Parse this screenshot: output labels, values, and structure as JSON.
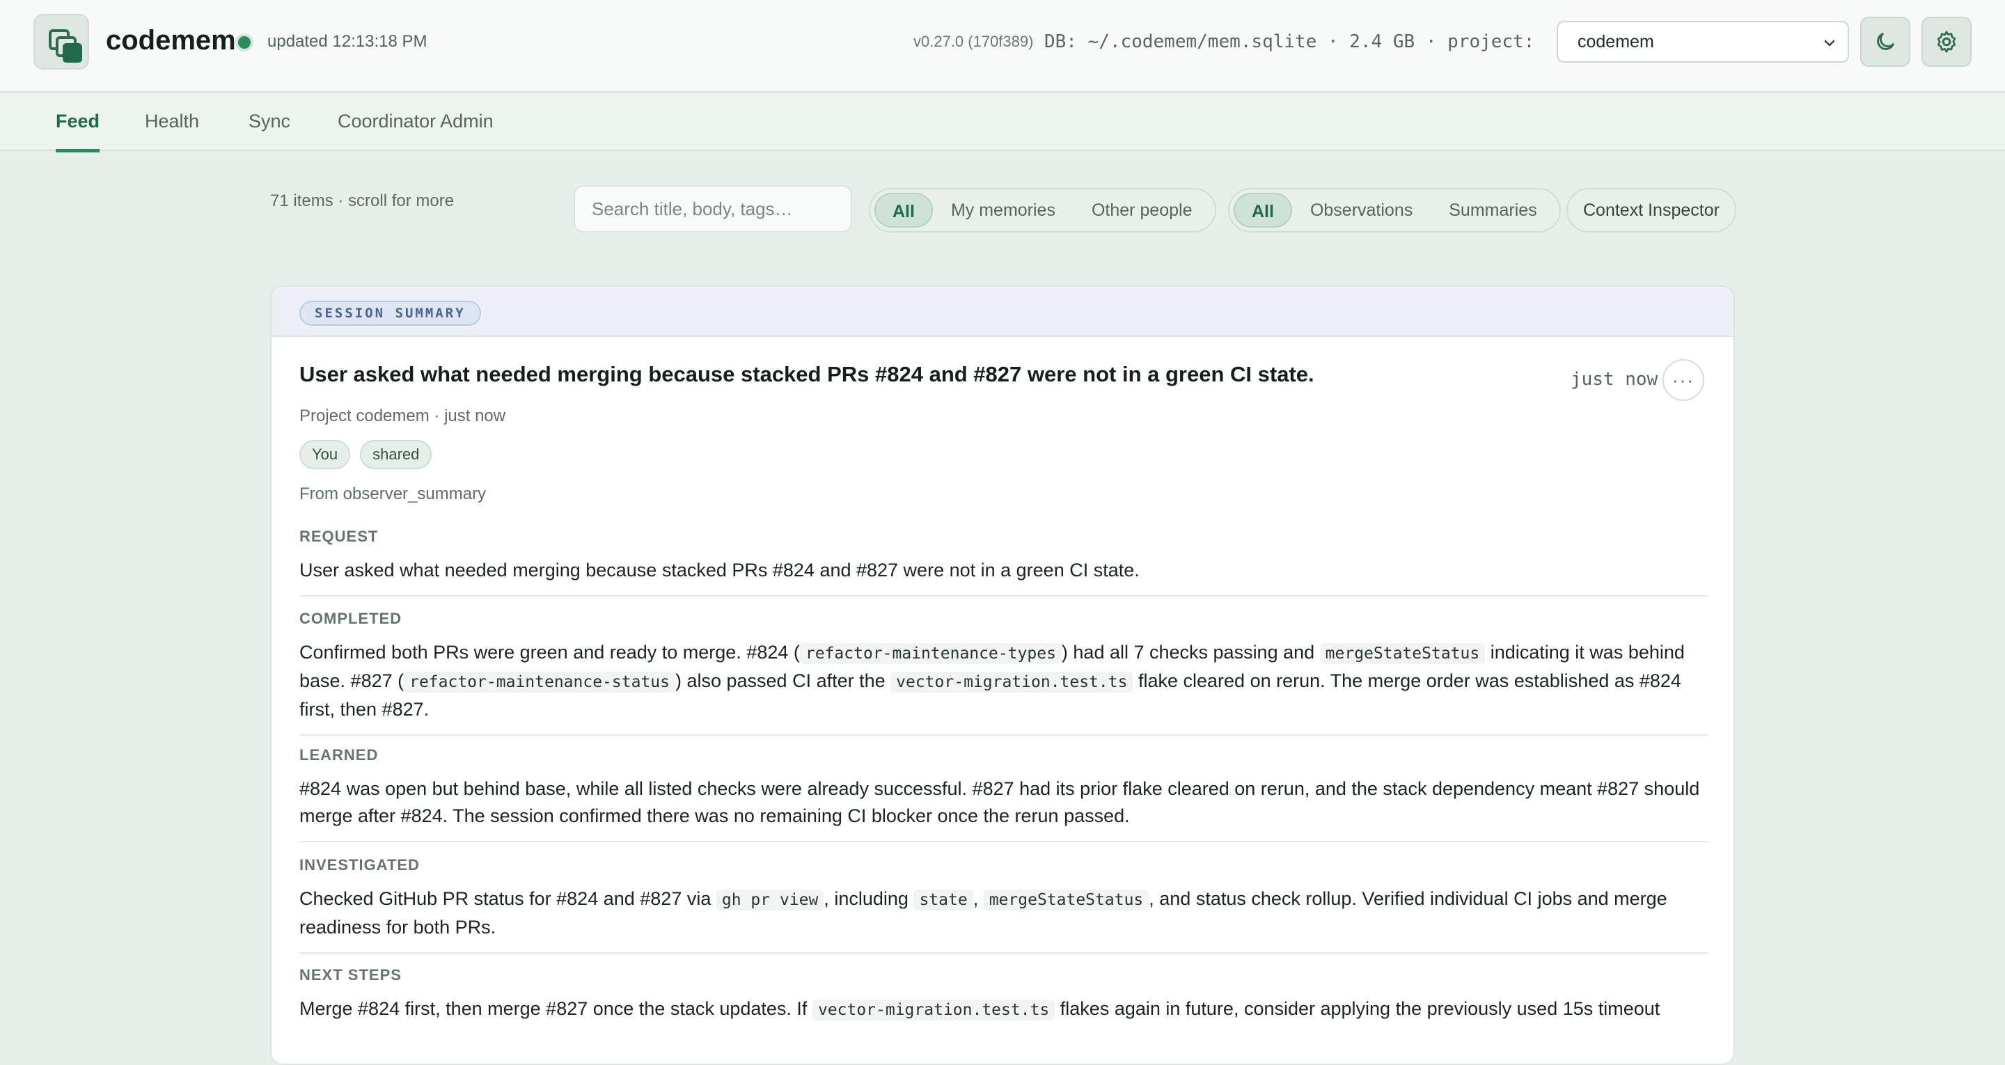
{
  "header": {
    "app_name": "codemem",
    "updated": "updated 12:13:18 PM",
    "version": "v0.27.0 (170f389)",
    "db_info": "DB: ~/.codemem/mem.sqlite · 2.4 GB · project: c…",
    "project_select_value": "codemem",
    "status_color": "#2e8a5e"
  },
  "tabs": [
    {
      "label": "Feed"
    },
    {
      "label": "Health"
    },
    {
      "label": "Sync"
    },
    {
      "label": "Coordinator Admin"
    }
  ],
  "toolbar": {
    "item_count": "71 items · scroll for more",
    "search_placeholder": "Search title, body, tags…",
    "owner_filter": [
      "All",
      "My memories",
      "Other people"
    ],
    "type_filter": [
      "All",
      "Observations",
      "Summaries"
    ],
    "context_inspector": "Context Inspector"
  },
  "card": {
    "badge": "SESSION SUMMARY",
    "title": "User asked what needed merging because stacked PRs #824 and #827 were not in a green CI state.",
    "time": "just now",
    "meta": "Project codemem · just now",
    "chips": [
      "You",
      "shared"
    ],
    "from": "From observer_summary",
    "sections": {
      "request": {
        "label": "REQUEST",
        "text": "User asked what needed merging because stacked PRs #824 and #827 were not in a green CI state."
      },
      "completed": {
        "label": "COMPLETED",
        "t1": "Confirmed both PRs were green and ready to merge. #824 (",
        "c1": "refactor-maintenance-types",
        "t2": ") had all 7 checks passing and ",
        "c2": "mergeStateStatus",
        "t3": " indicating it was behind base. #827 (",
        "c3": "refactor-maintenance-status",
        "t4": ") also passed CI after the ",
        "c4": "vector-migration.test.ts",
        "t5": " flake cleared on rerun. The merge order was established as #824 first, then #827."
      },
      "learned": {
        "label": "LEARNED",
        "text": "#824 was open but behind base, while all listed checks were already successful. #827 had its prior flake cleared on rerun, and the stack dependency meant #827 should merge after #824. The session confirmed there was no remaining CI blocker once the rerun passed."
      },
      "investigated": {
        "label": "INVESTIGATED",
        "t1": "Checked GitHub PR status for #824 and #827 via ",
        "c1": "gh pr view",
        "t2": ", including ",
        "c2": "state",
        "t3": ", ",
        "c3": "mergeStateStatus",
        "t4": ", and status check rollup. Verified individual CI jobs and merge readiness for both PRs."
      },
      "next_steps": {
        "label": "NEXT STEPS",
        "t1": "Merge #824 first, then merge #827 once the stack updates. If ",
        "c1": "vector-migration.test.ts",
        "t2": " flakes again in future, consider applying the previously used 15s timeout"
      }
    }
  }
}
